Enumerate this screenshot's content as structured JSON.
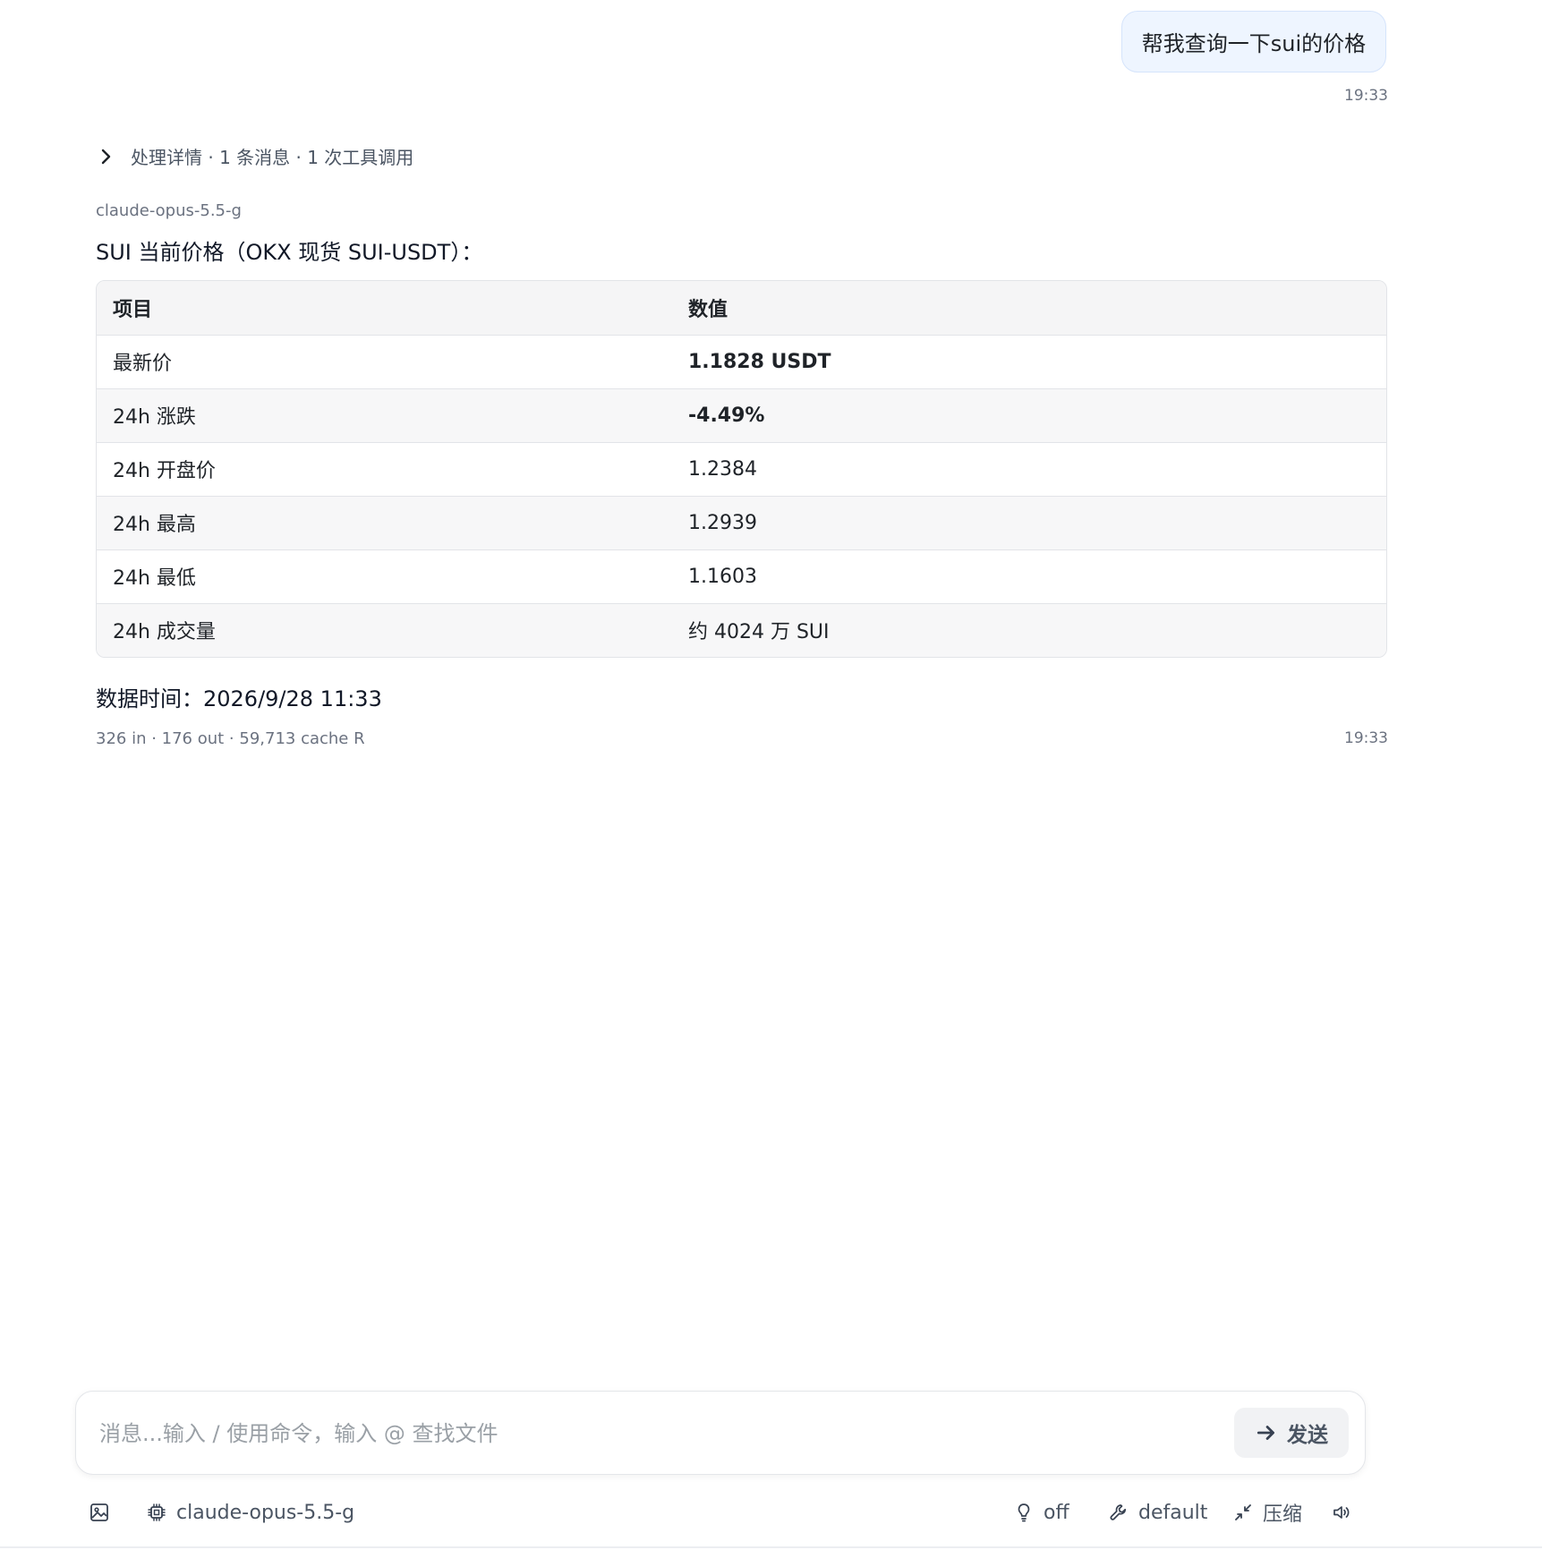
{
  "user_message": {
    "text": "帮我查询一下sui的价格",
    "time": "19:33"
  },
  "process_details": {
    "label": "处理详情 · 1 条消息 · 1 次工具调用",
    "icon": "chevron-right-icon"
  },
  "assistant": {
    "model": "claude-opus-5.5-g",
    "intro": "SUI 当前价格（OKX 现货 SUI-USDT）：",
    "table": {
      "headers": [
        "项目",
        "数值"
      ],
      "rows": [
        {
          "item": "最新价",
          "value": "1.1828 USDT",
          "bold": true
        },
        {
          "item": "24h 涨跌",
          "value": "-4.49%",
          "bold": true
        },
        {
          "item": "24h 开盘价",
          "value": "1.2384",
          "bold": false
        },
        {
          "item": "24h 最高",
          "value": "1.2939",
          "bold": false
        },
        {
          "item": "24h 最低",
          "value": "1.1603",
          "bold": false
        },
        {
          "item": "24h 成交量",
          "value": "约 4024 万 SUI",
          "bold": false
        }
      ]
    },
    "data_time": "数据时间：2026/9/28 11:33",
    "usage": "326 in · 176 out · 59,713 cache R",
    "time": "19:33"
  },
  "composer": {
    "placeholder": "消息...输入 / 使用命令，输入 @ 查找文件",
    "value": "",
    "send_label": "发送",
    "send_icon": "arrow-right-icon"
  },
  "toolbar": {
    "image_icon": "image-icon",
    "model_icon": "chip-icon",
    "model_label": "claude-opus-5.5-g",
    "thinking_icon": "lightbulb-icon",
    "thinking_label": "off",
    "tools_icon": "wrench-icon",
    "tools_label": "default",
    "compress_icon": "compress-icon",
    "compress_label": "压缩",
    "audio_icon": "speaker-icon"
  },
  "colors": {
    "user_bubble_bg": "#eef5ff",
    "table_header_bg": "#f5f5f6",
    "text_muted": "#6b7280",
    "send_button_bg": "#f1f2f4"
  }
}
